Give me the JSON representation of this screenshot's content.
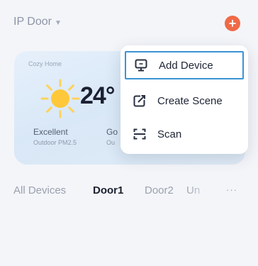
{
  "header": {
    "home_name": "IP Door",
    "add_symbol": "+"
  },
  "weather": {
    "card_label": "Cozy Home",
    "temperature": "24°",
    "air_quality_label": "Excellent",
    "air_quality_sub": "Outdoor PM2.5",
    "humidity_label": "Go",
    "humidity_sub": "Ou"
  },
  "menu": {
    "items": [
      {
        "label": "Add Device",
        "icon": "add-device-icon",
        "highlighted": true
      },
      {
        "label": "Create Scene",
        "icon": "create-scene-icon",
        "highlighted": false
      },
      {
        "label": "Scan",
        "icon": "scan-icon",
        "highlighted": false
      }
    ]
  },
  "tabs": {
    "items": [
      {
        "label": "All Devices",
        "active": false
      },
      {
        "label": "Door1",
        "active": true
      },
      {
        "label": "Door2",
        "active": false
      },
      {
        "label": "Un",
        "active": false
      }
    ],
    "more_label": "···"
  },
  "colors": {
    "accent": "#ef6a47",
    "highlight_border": "#3a93d6",
    "icon": "#2a3142",
    "sun": "#ffc83a"
  }
}
